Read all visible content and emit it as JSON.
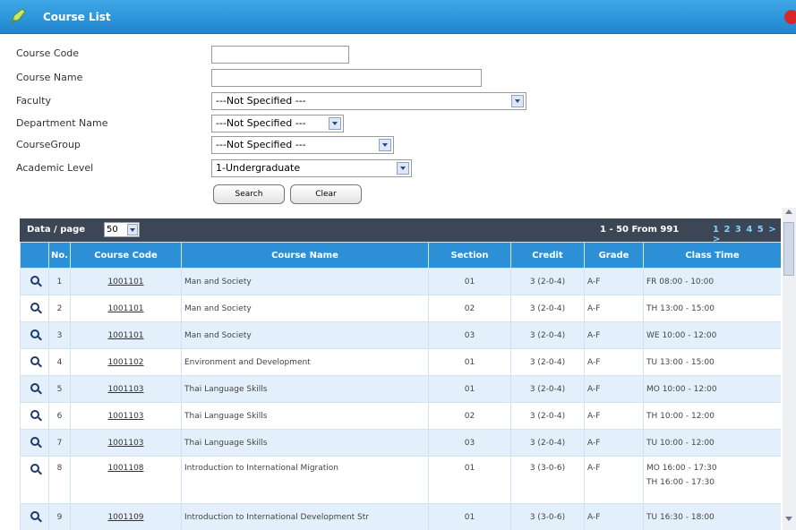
{
  "window": {
    "title": "Course List"
  },
  "form": {
    "course_code_label": "Course Code",
    "course_code_value": "",
    "course_name_label": "Course Name",
    "course_name_value": "",
    "faculty_label": "Faculty",
    "faculty_value": "---Not Specified ---",
    "department_label": "Department Name",
    "department_value": "---Not Specified ---",
    "coursegroup_label": "CourseGroup",
    "coursegroup_value": "---Not Specified ---",
    "academic_level_label": "Academic Level",
    "academic_level_value": "1-Undergraduate",
    "search_button": "Search",
    "clear_button": "Clear"
  },
  "pager": {
    "per_page_label": "Data / page",
    "per_page_value": "50",
    "range_text": "1 - 50 From 991",
    "pages_text": "1 2 3 4 5 > >"
  },
  "table": {
    "headers": [
      "",
      "No.",
      "Course Code",
      "Course Name",
      "Section",
      "Credit",
      "Grade",
      "Class Time"
    ],
    "rows": [
      {
        "no": "1",
        "code": "1001101",
        "name": "Man and Society",
        "section": "01",
        "credit": "3 (2-0-4)",
        "grade": "A-F",
        "time": "FR 08:00 - 10:00",
        "time2": ""
      },
      {
        "no": "2",
        "code": "1001101",
        "name": "Man and Society",
        "section": "02",
        "credit": "3 (2-0-4)",
        "grade": "A-F",
        "time": "TH 13:00 - 15:00",
        "time2": ""
      },
      {
        "no": "3",
        "code": "1001101",
        "name": "Man and Society",
        "section": "03",
        "credit": "3 (2-0-4)",
        "grade": "A-F",
        "time": "WE 10:00 - 12:00",
        "time2": ""
      },
      {
        "no": "4",
        "code": "1001102",
        "name": "Environment and Development",
        "section": "01",
        "credit": "3 (2-0-4)",
        "grade": "A-F",
        "time": "TU 13:00 - 15:00",
        "time2": ""
      },
      {
        "no": "5",
        "code": "1001103",
        "name": "Thai Language Skills",
        "section": "01",
        "credit": "3 (2-0-4)",
        "grade": "A-F",
        "time": "MO 10:00 - 12:00",
        "time2": ""
      },
      {
        "no": "6",
        "code": "1001103",
        "name": "Thai Language Skills",
        "section": "02",
        "credit": "3 (2-0-4)",
        "grade": "A-F",
        "time": "TH 10:00 - 12:00",
        "time2": ""
      },
      {
        "no": "7",
        "code": "1001103",
        "name": "Thai Language Skills",
        "section": "03",
        "credit": "3 (2-0-4)",
        "grade": "A-F",
        "time": "TU 10:00 - 12:00",
        "time2": ""
      },
      {
        "no": "8",
        "code": "1001108",
        "name": "Introduction to International Migration",
        "section": "01",
        "credit": "3 (3-0-6)",
        "grade": "A-F",
        "time": "MO 16:00 - 17:30",
        "time2": "TH 16:00 - 17:30"
      },
      {
        "no": "9",
        "code": "1001109",
        "name": "Introduction to International Development Str",
        "section": "01",
        "credit": "3 (3-0-6)",
        "grade": "A-F",
        "time": "TU 16:30 - 18:00",
        "time2": ""
      }
    ]
  }
}
